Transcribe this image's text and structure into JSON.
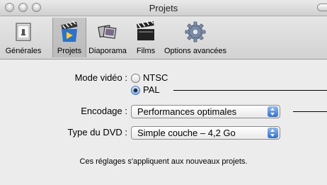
{
  "window": {
    "title": "Projets"
  },
  "toolbar": {
    "items": [
      {
        "label": "Générales",
        "icon": "general-prefs-icon"
      },
      {
        "label": "Projets",
        "icon": "projects-icon",
        "selected": true
      },
      {
        "label": "Diaporama",
        "icon": "slideshow-icon"
      },
      {
        "label": "Films",
        "icon": "film-clapper-icon"
      },
      {
        "label": "Options avancées",
        "icon": "advanced-gear-icon"
      }
    ]
  },
  "form": {
    "video_mode_label": "Mode vidéo :",
    "video_mode_options": [
      "NTSC",
      "PAL"
    ],
    "video_mode_selected": "PAL",
    "encoding_label": "Encodage :",
    "encoding_value": "Performances optimales",
    "dvd_type_label": "Type du DVD :",
    "dvd_type_value": "Simple couche – 4,2 Go"
  },
  "note": "Ces réglages s'appliquent aux nouveaux projets.",
  "colors": {
    "accent": "#2f6fd3",
    "background": "#ececec"
  }
}
